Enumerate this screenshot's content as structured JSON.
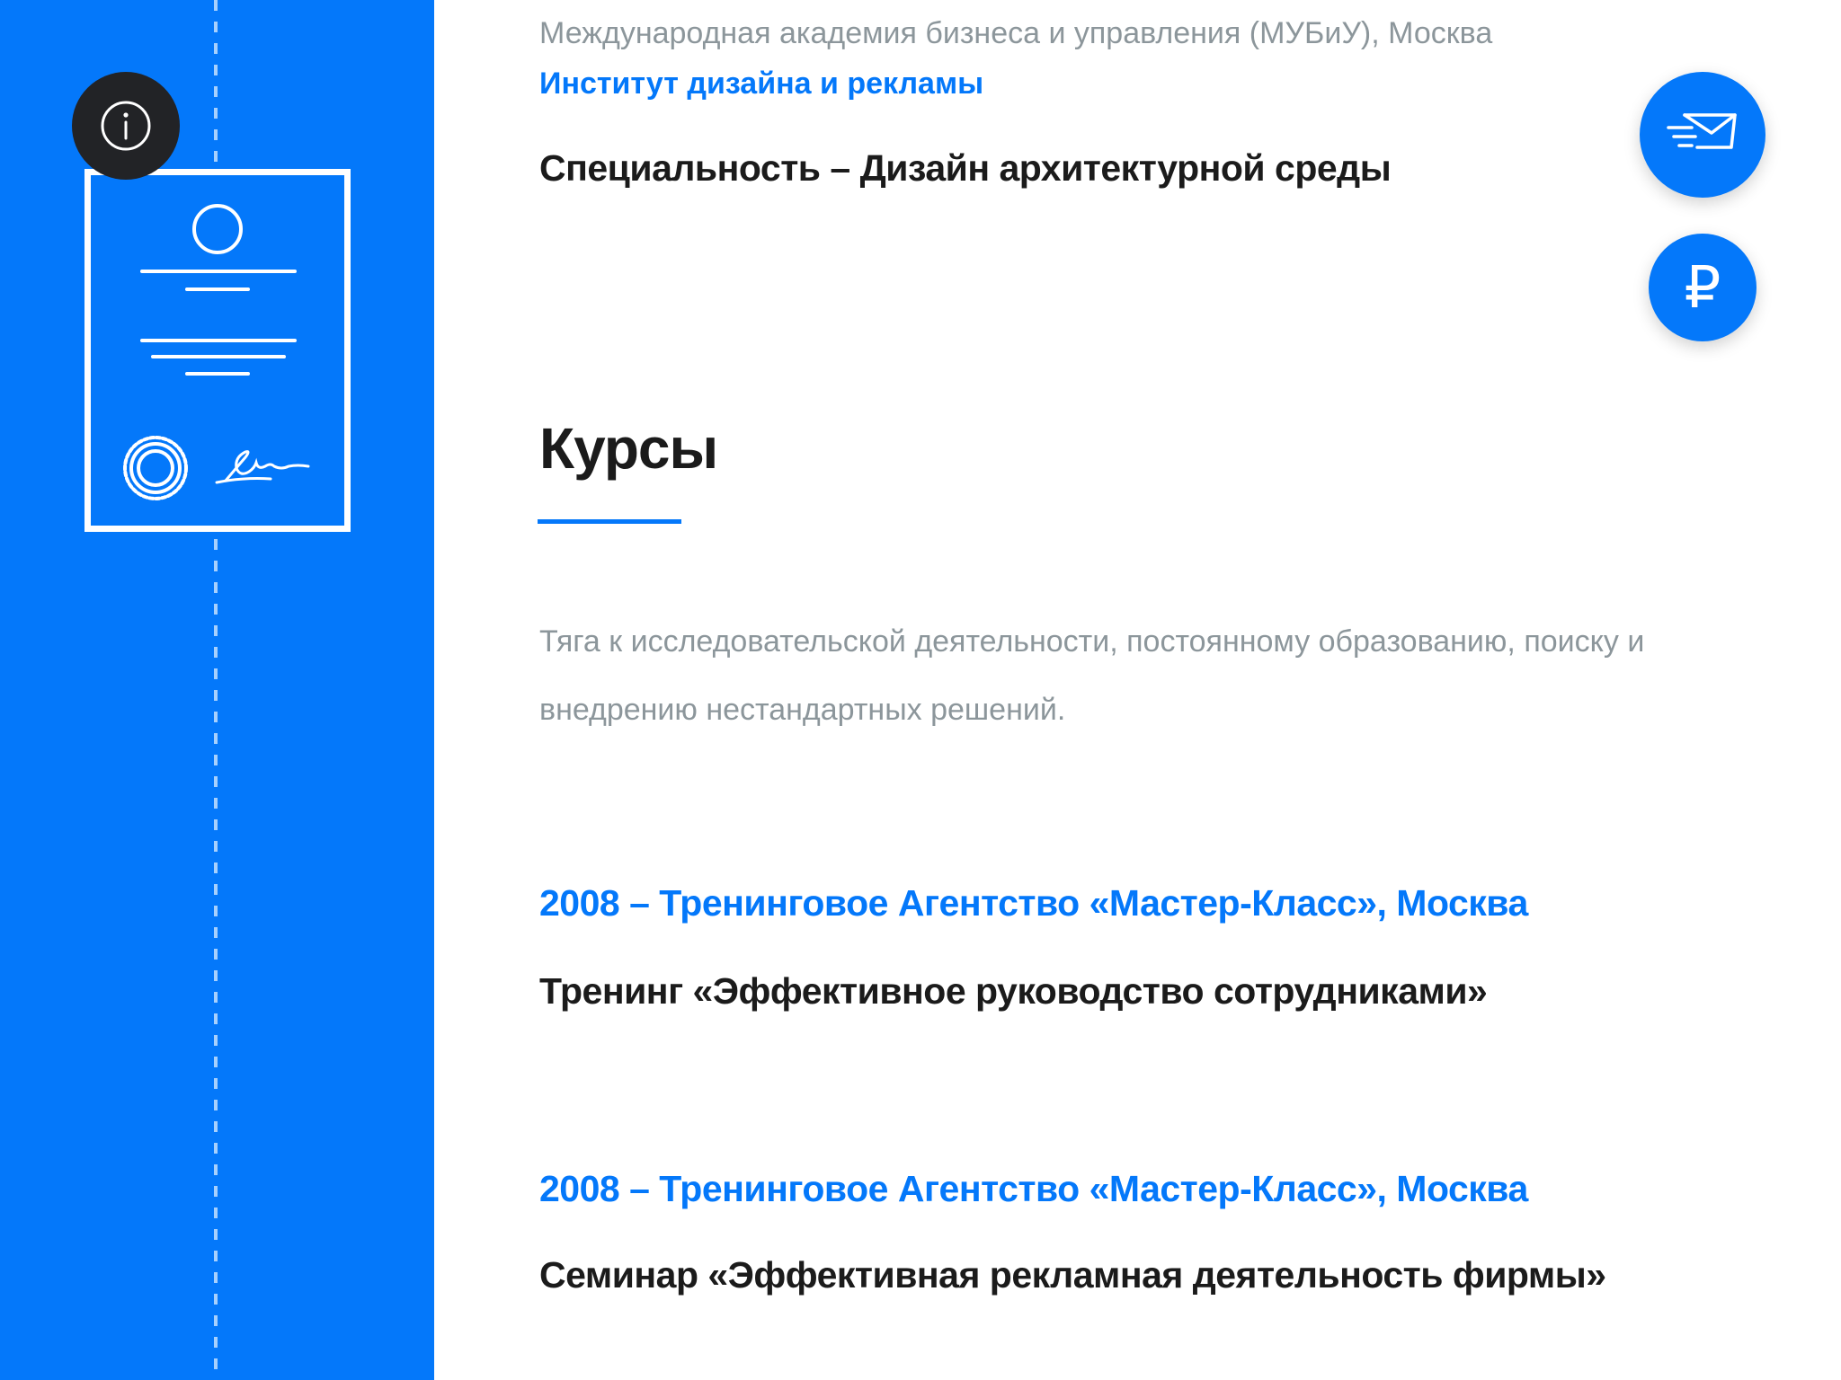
{
  "sidebar": {
    "info_icon": "info-icon",
    "illustration": "diploma-icon",
    "colors": {
      "background": "#0478FA",
      "info_button": "#222326"
    }
  },
  "education": {
    "academy": "Международная академия бизнеса и управления (МУБиУ), Москва",
    "institute": "Институт дизайна и рекламы",
    "specialty": "Специальность – Дизайн архитектурной среды"
  },
  "courses": {
    "title": "Курсы",
    "description": "Тяга к исследовательской деятельности, постоянному образованию, поиску и внедрению нестандартных решений.",
    "items": [
      {
        "org": "2008 – Тренинговое Агентство «Мастер-Класс», Москва",
        "name": "Тренинг «Эффективное руководство сотрудниками»"
      },
      {
        "org": "2008 – Тренинговое Агентство «Мастер-Класс», Москва",
        "name": "Семинар «Эффективная рекламная деятельность фирмы»"
      }
    ]
  },
  "fabs": {
    "mail_icon": "mail-send-icon",
    "ruble_icon": "ruble-icon",
    "ruble_symbol": "₽"
  },
  "colors": {
    "accent": "#0478FA",
    "text_dark": "#1B1B1B",
    "text_muted": "#8C969B"
  }
}
